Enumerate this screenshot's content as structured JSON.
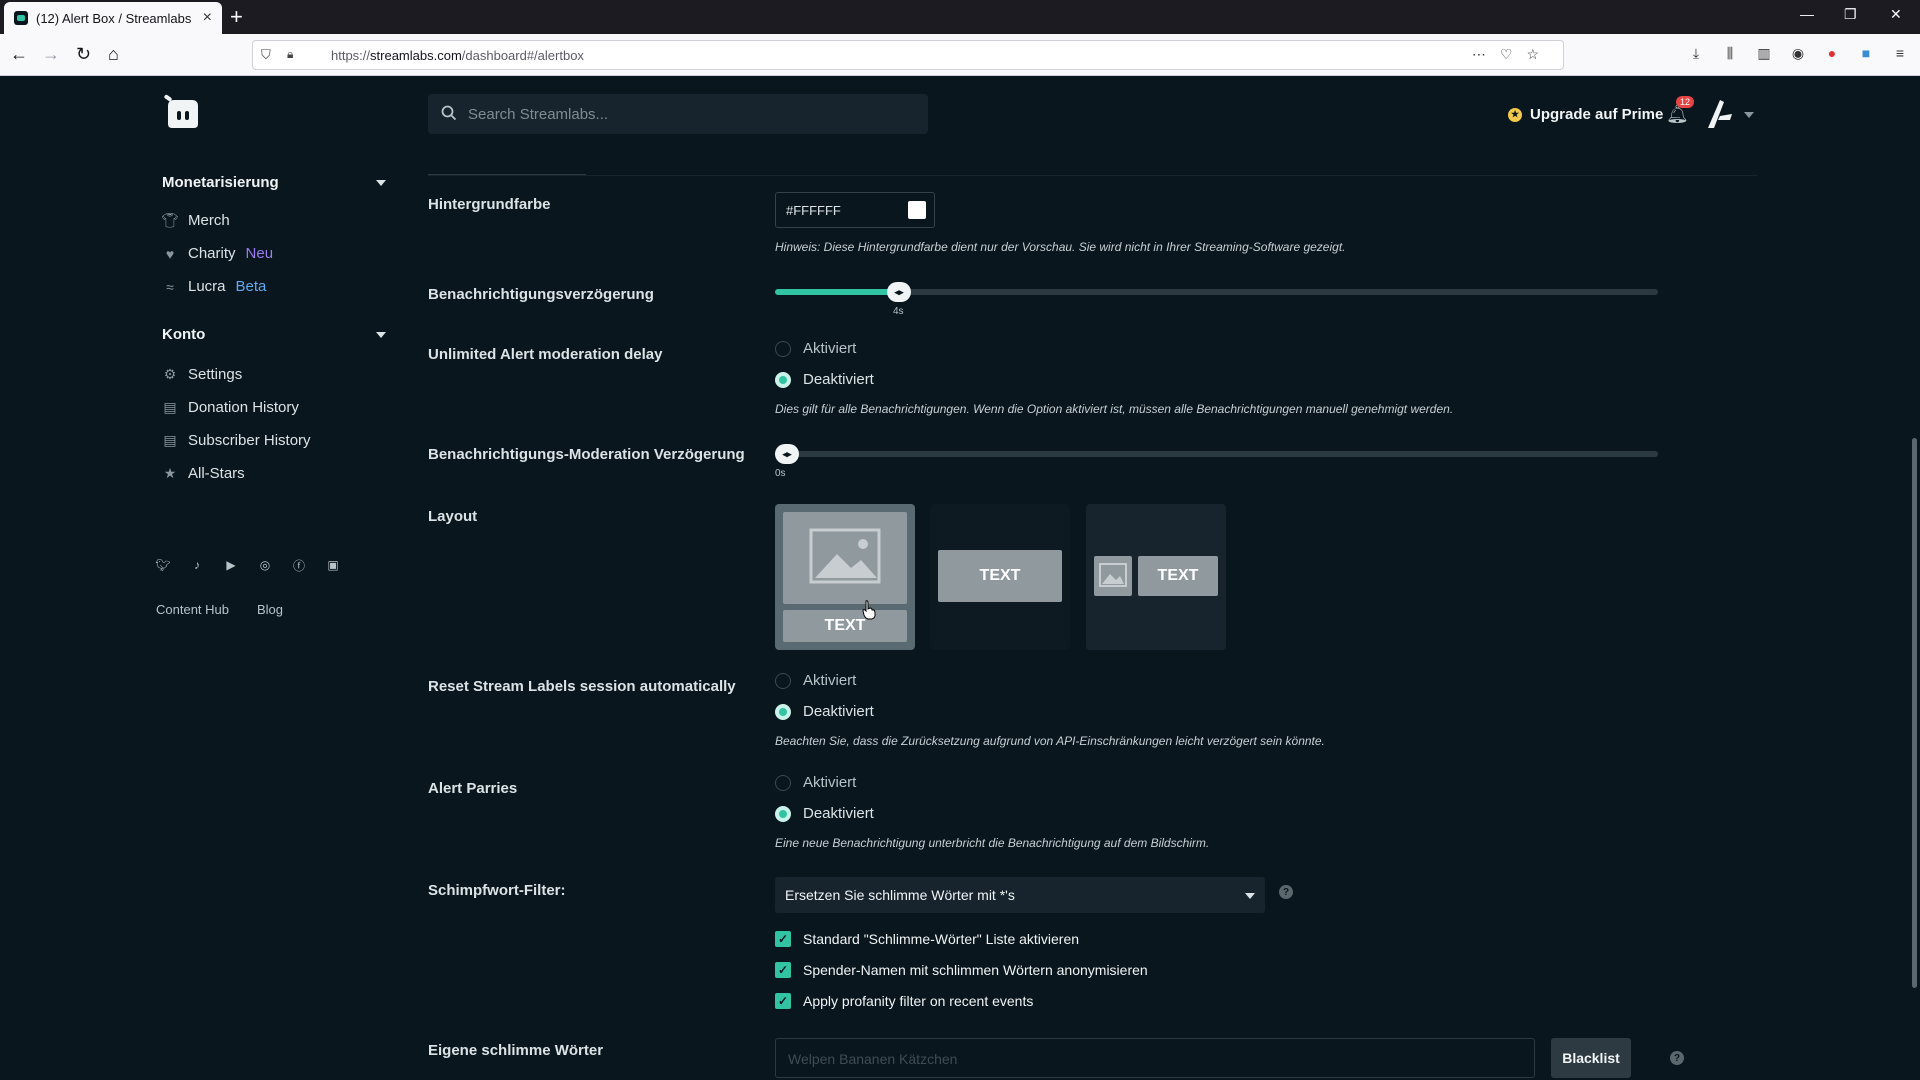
{
  "browser": {
    "tab_title": "(12) Alert Box / Streamlabs",
    "url_prefix": "https://",
    "url_domain": "streamlabs.com",
    "url_path": "/dashboard#/alertbox"
  },
  "sidebar": {
    "section1": "Monetarisierung",
    "items1": [
      {
        "label": "Merch",
        "badge": ""
      },
      {
        "label": "Charity",
        "badge": "Neu"
      },
      {
        "label": "Lucra",
        "badge": "Beta"
      }
    ],
    "section2": "Konto",
    "items2": [
      {
        "label": "Settings"
      },
      {
        "label": "Donation History"
      },
      {
        "label": "Subscriber History"
      },
      {
        "label": "All-Stars"
      }
    ],
    "footer_links": [
      "Content Hub",
      "Blog"
    ]
  },
  "header": {
    "search_placeholder": "Search Streamlabs...",
    "upgrade_label": "Upgrade auf Prime",
    "notification_count": "12"
  },
  "form": {
    "bg_color_label": "Hintergrundfarbe",
    "bg_color_value": "#FFFFFF",
    "bg_color_hint": "Hinweis: Diese Hintergrundfarbe dient nur der Vorschau. Sie wird nicht in Ihrer Streaming-Software gezeigt.",
    "delay_label": "Benachrichtigungsverzögerung",
    "delay_value": "4s",
    "delay_fraction": 0.14,
    "unlimited_label": "Unlimited Alert moderation delay",
    "opt_on": "Aktiviert",
    "opt_off": "Deaktiviert",
    "unlimited_hint": "Dies gilt für alle Benachrichtigungen. Wenn die Option aktiviert ist, müssen alle Benachrichtigungen manuell genehmigt werden.",
    "mod_delay_label": "Benachrichtigungs-Moderation Verzögerung",
    "mod_delay_value": "0s",
    "mod_delay_fraction": 0,
    "layout_label": "Layout",
    "layout_text": "TEXT",
    "reset_label": "Reset Stream Labels session automatically",
    "reset_hint": "Beachten Sie, dass die Zurücksetzung aufgrund von API-Einschränkungen leicht verzögert sein könnte.",
    "parries_label": "Alert Parries",
    "parries_hint": "Eine neue Benachrichtigung unterbricht die Benachrichtigung auf dem Bildschirm.",
    "profanity_label": "Schimpfwort-Filter:",
    "profanity_value": "Ersetzen Sie schlimme Wörter mit *'s",
    "check1": "Standard \"Schlimme-Wörter\" Liste aktivieren",
    "check2": "Spender-Namen mit schlimmen Wörtern anonymisieren",
    "check3": "Apply profanity filter on recent events",
    "own_words_label": "Eigene schlimme Wörter",
    "own_words_placeholder": "Welpen Bananen Kätzchen",
    "blacklist_label": "Blacklist"
  },
  "colors": {
    "accent": "#31c3a2",
    "background": "#09161d"
  }
}
